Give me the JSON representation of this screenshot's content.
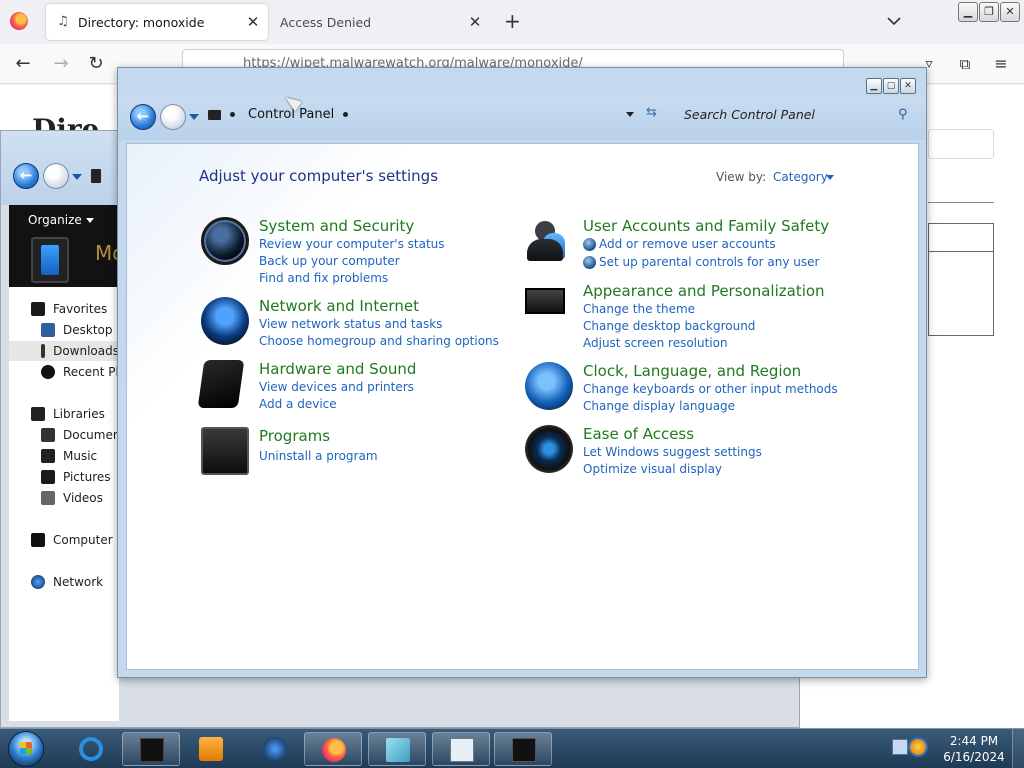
{
  "browser": {
    "tabs": [
      {
        "label": "Directory: monoxide",
        "active": true
      },
      {
        "label": "Access Denied",
        "active": false
      }
    ],
    "new_tab_symbol": "+",
    "close_symbol": "✕",
    "url": "https://wipet.malwarewatch.org/malware/monoxide/"
  },
  "webpage": {
    "heading": "Dire"
  },
  "explorer": {
    "organize_label": "Organize",
    "folder_title": "Mo",
    "sidebar": [
      {
        "label": "Favorites",
        "icon": "favorites-icon"
      },
      {
        "label": "Desktop",
        "icon": "desktop-icon"
      },
      {
        "label": "Downloads",
        "icon": "downloads-icon"
      },
      {
        "label": "Recent Plac",
        "icon": "recent-places-icon"
      },
      {
        "label": "Libraries",
        "icon": "libraries-icon"
      },
      {
        "label": "Document",
        "icon": "documents-icon"
      },
      {
        "label": "Music",
        "icon": "music-icon"
      },
      {
        "label": "Pictures",
        "icon": "pictures-icon"
      },
      {
        "label": "Videos",
        "icon": "videos-icon"
      },
      {
        "label": "Computer",
        "icon": "computer-icon"
      },
      {
        "label": "Network",
        "icon": "network-icon"
      }
    ]
  },
  "control_panel": {
    "breadcrumb": "Control Panel",
    "search_placeholder": "Search Control Panel",
    "heading": "Adjust your computer's settings",
    "view_by_label": "View by:",
    "view_by_value": "Category",
    "categories_left": [
      {
        "title": "System and Security",
        "icon": "system-security-icon",
        "links": [
          "Review your computer's status",
          "Back up your computer",
          "Find and fix problems"
        ]
      },
      {
        "title": "Network and Internet",
        "icon": "network-internet-icon",
        "links": [
          "View network status and tasks",
          "Choose homegroup and sharing options"
        ]
      },
      {
        "title": "Hardware and Sound",
        "icon": "hardware-sound-icon",
        "links": [
          "View devices and printers",
          "Add a device"
        ]
      },
      {
        "title": "Programs",
        "icon": "programs-icon",
        "links": [
          "Uninstall a program"
        ]
      }
    ],
    "categories_right": [
      {
        "title": "User Accounts and Family Safety",
        "icon": "user-accounts-icon",
        "links": [
          "Add or remove user accounts",
          "Set up parental controls for any user"
        ]
      },
      {
        "title": "Appearance and Personalization",
        "icon": "appearance-icon",
        "links": [
          "Change the theme",
          "Change desktop background",
          "Adjust screen resolution"
        ]
      },
      {
        "title": "Clock, Language, and Region",
        "icon": "clock-language-icon",
        "links": [
          "Change keyboards or other input methods",
          "Change display language"
        ]
      },
      {
        "title": "Ease of Access",
        "icon": "ease-of-access-icon",
        "links": [
          "Let Windows suggest settings",
          "Optimize visual display"
        ]
      }
    ]
  },
  "taskbar": {
    "time": "2:44 PM",
    "date": "6/16/2024"
  },
  "colors": {
    "category_title": "#1f7a1f",
    "link": "#1e64be",
    "heading": "#1e3287"
  }
}
